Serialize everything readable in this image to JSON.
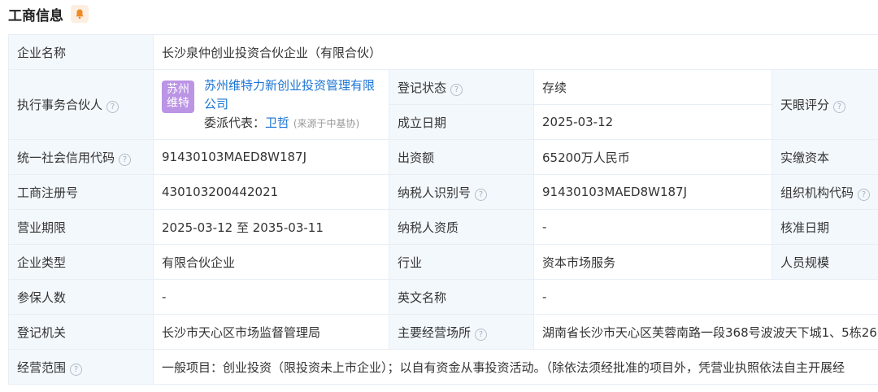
{
  "header": {
    "title": "工商信息",
    "icon": "bell-icon",
    "accent": "#f08a24"
  },
  "row1": {
    "name_label": "企业名称",
    "name_value": "长沙泉仲创业投资合伙企业（有限合伙）"
  },
  "partner": {
    "label": "执行事务合伙人",
    "logo_line1": "苏州",
    "logo_line2": "维特",
    "name": "苏州维特力新创业投资管理有限公司",
    "delegate_label": "委派代表：",
    "delegate_name": "卫哲",
    "delegate_note": "(来源于中基协)"
  },
  "status": {
    "label": "登记状态",
    "value": "存续"
  },
  "founded": {
    "label": "成立日期",
    "value": "2025-03-12"
  },
  "tianyan": {
    "label": "天眼评分"
  },
  "credit_code": {
    "label": "统一社会信用代码",
    "value": "91430103MAED8W187J"
  },
  "capital": {
    "label": "出资额",
    "value": "65200万人民币"
  },
  "paid_capital": {
    "label": "实缴资本"
  },
  "reg_no": {
    "label": "工商注册号",
    "value": "430103200442021"
  },
  "taxpayer_id": {
    "label": "纳税人识别号",
    "value": "91430103MAED8W187J"
  },
  "org_code": {
    "label": "组织机构代码"
  },
  "term": {
    "label": "营业期限",
    "value": "2025-03-12 至 2035-03-11"
  },
  "taxpayer_qual": {
    "label": "纳税人资质",
    "value": "-"
  },
  "approve_date": {
    "label": "核准日期"
  },
  "type": {
    "label": "企业类型",
    "value": "有限合伙企业"
  },
  "industry": {
    "label": "行业",
    "value": "资本市场服务"
  },
  "staff_size": {
    "label": "人员规模"
  },
  "insured": {
    "label": "参保人数",
    "value": "-"
  },
  "english_name": {
    "label": "英文名称",
    "value": "-"
  },
  "authority": {
    "label": "登记机关",
    "value": "长沙市天心区市场监督管理局"
  },
  "address": {
    "label": "主要经营场所",
    "value": "湖南省长沙市天心区芙蓉南路一段368号波波天下城1、5栋26"
  },
  "scope": {
    "label": "经营范围",
    "value": "一般项目：创业投资（限投资未上市企业）；以自有资金从事投资活动。（除依法须经批准的项目外，凭营业执照依法自主开展经"
  }
}
